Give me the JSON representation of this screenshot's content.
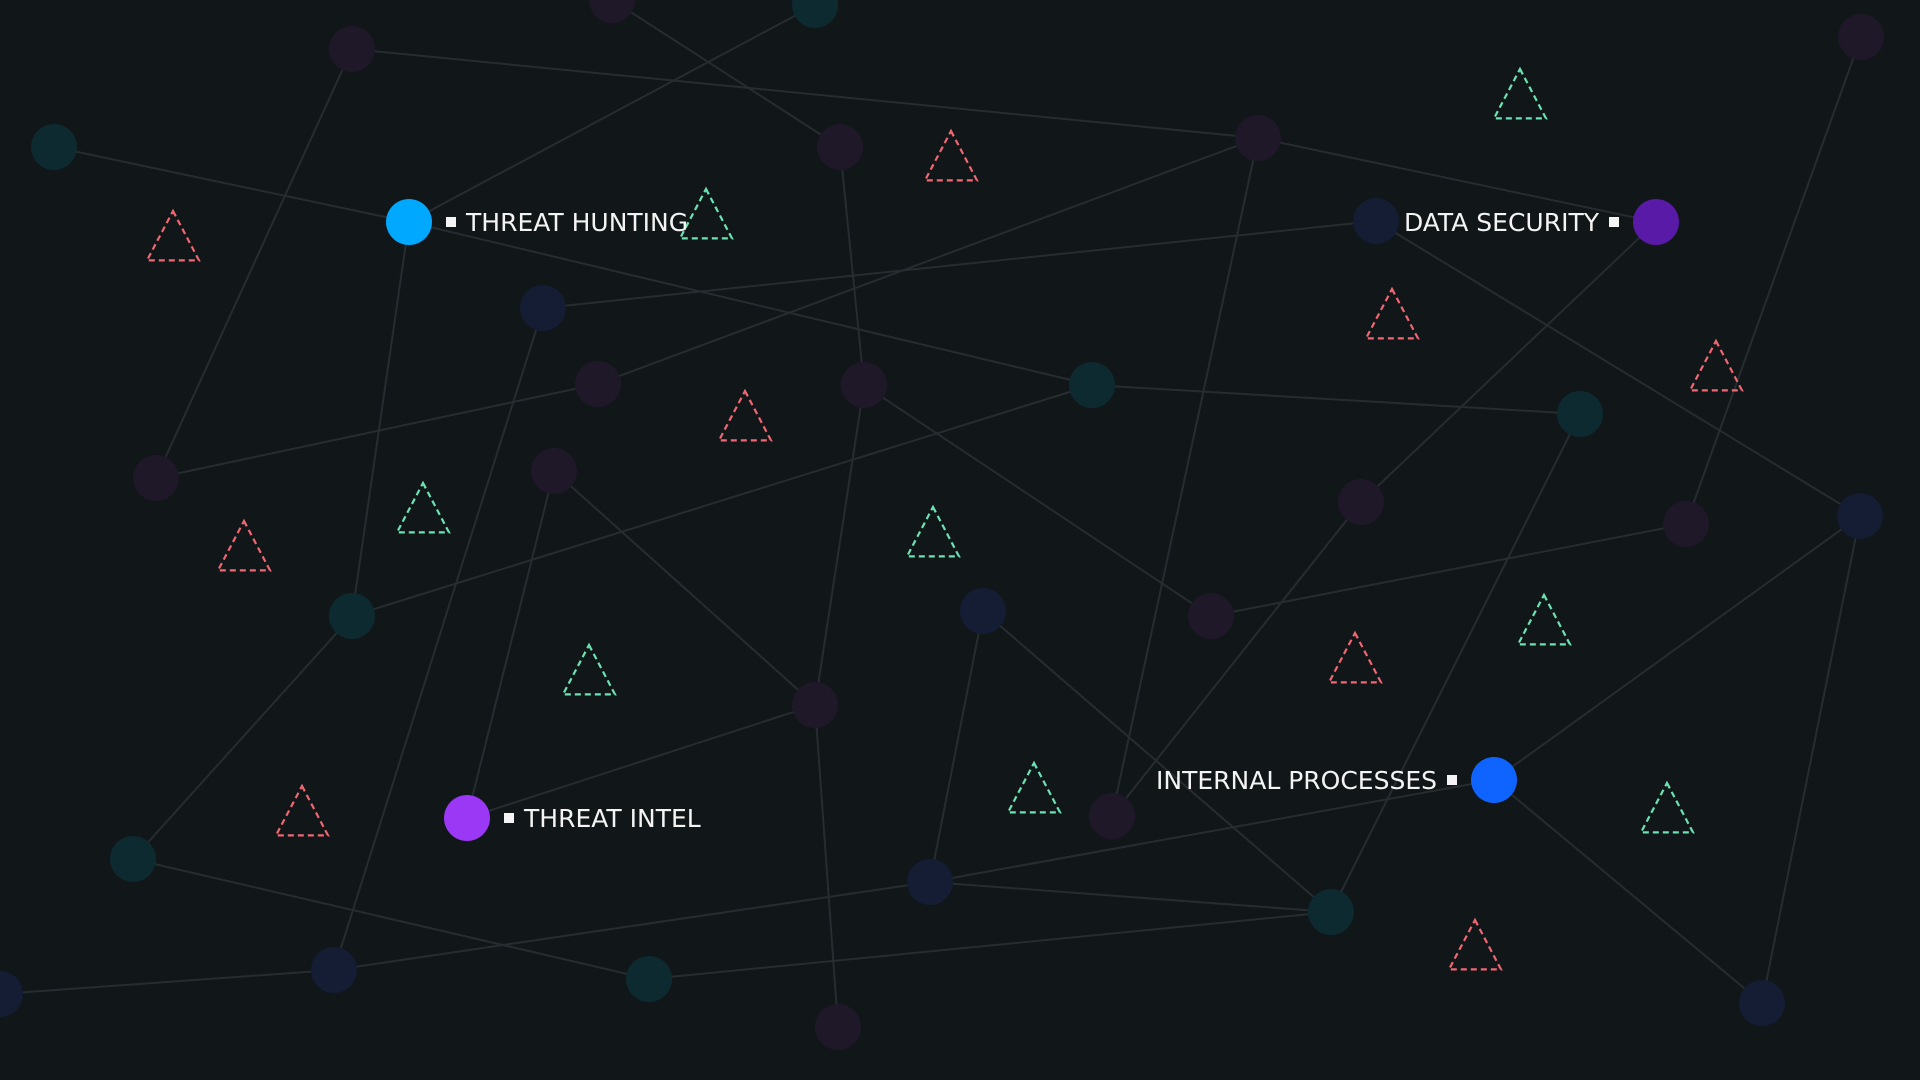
{
  "hubs": [
    {
      "id": "threat-hunting",
      "label": "THREAT HUNTING",
      "color": "#00a8ff"
    },
    {
      "id": "data-security",
      "label": "DATA SECURITY",
      "color": "#5a1aa8"
    },
    {
      "id": "threat-intel",
      "label": "THREAT INTEL",
      "color": "#9a38f5"
    },
    {
      "id": "internal-processes",
      "label": "INTERNAL PROCESSES",
      "color": "#0f64ff"
    }
  ],
  "colors": {
    "background": "#111618",
    "edge": "#262c30",
    "node_teal": "#0e2a31",
    "node_purple": "#1f1829",
    "node_navy": "#141d33",
    "triangle_red": "#f06672",
    "triangle_green": "#6be3b2",
    "label_text": "#f4f4f4"
  },
  "icons": {
    "hub_marker": "square-bullet-icon",
    "warning": "warning-triangle-icon"
  }
}
